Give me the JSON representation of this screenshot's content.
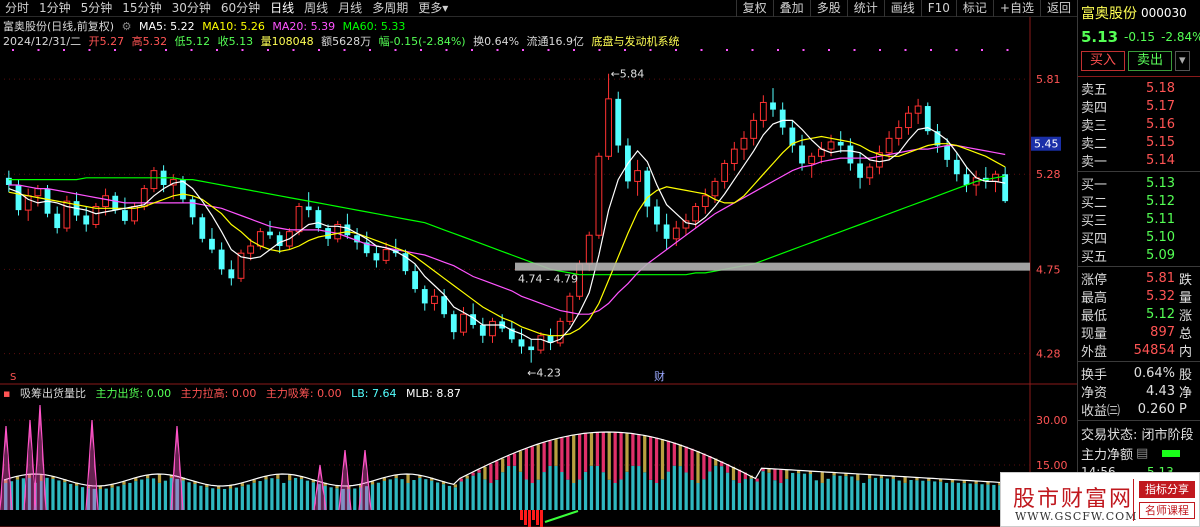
{
  "toolbar": {
    "tabs": [
      "分时",
      "1分钟",
      "5分钟",
      "15分钟",
      "30分钟",
      "60分钟",
      "日线",
      "周线",
      "月线",
      "多周期",
      "更多"
    ],
    "more_arrow": "▾",
    "buttons": [
      "复权",
      "叠加",
      "多股",
      "统计",
      "画线",
      "F10",
      "标记",
      "+自选",
      "返回"
    ]
  },
  "info": {
    "stock_title": "富奥股份(日线,前复权)",
    "ma5": "MA5: 5.22",
    "ma10": "MA10: 5.26",
    "ma20": "MA20: 5.39",
    "ma60": "MA60: 5.33",
    "date": "2024/12/31/二",
    "open": "开5.27",
    "high": "高5.32",
    "low": "低5.12",
    "close": "收5.13",
    "volume": "量108048",
    "amount": "额5628万",
    "change": "幅-0.15(-2.84%)",
    "turnover": "换0.64%",
    "float_cap": "流通16.9亿",
    "system": "底盘与发动机系统"
  },
  "chart_annotations": {
    "high_label": "5.84",
    "low_label": "4.23",
    "range_label": "4.74 - 4.79",
    "finance_mark": "财",
    "price_marker": "5.45"
  },
  "indicator": {
    "name": "吸筹出货量比",
    "main_out": "主力出货: 0.00",
    "main_up": "主力拉高: 0.00",
    "main_in": "主力吸筹: 0.00",
    "lb": "LB: 7.64",
    "mlb": "MLB: 8.87"
  },
  "colors": {
    "up": "#ff3232",
    "down": "#54ffff",
    "ma5": "#ffffff",
    "ma10": "#ffff00",
    "ma20": "#ff54ff",
    "ma60": "#00ff00"
  },
  "panel": {
    "name": "富奥股份",
    "code": "000030",
    "price": "5.13",
    "change": "-0.15",
    "pct": "-2.84%",
    "buy_btn": "买入",
    "sell_btn": "卖出",
    "more_btn": "▾",
    "asks": [
      {
        "label": "卖五",
        "price": "5.18"
      },
      {
        "label": "卖四",
        "price": "5.17"
      },
      {
        "label": "卖三",
        "price": "5.16"
      },
      {
        "label": "卖二",
        "price": "5.15"
      },
      {
        "label": "卖一",
        "price": "5.14"
      }
    ],
    "bids": [
      {
        "label": "买一",
        "price": "5.13"
      },
      {
        "label": "买二",
        "price": "5.12"
      },
      {
        "label": "买三",
        "price": "5.11"
      },
      {
        "label": "买四",
        "price": "5.10"
      },
      {
        "label": "买五",
        "price": "5.09"
      }
    ],
    "stats": [
      {
        "label": "涨停",
        "value": "5.81",
        "tail": "跌"
      },
      {
        "label": "最高",
        "value": "5.32",
        "tail": "量"
      },
      {
        "label": "最低",
        "value": "5.12",
        "tail": "涨"
      },
      {
        "label": "现量",
        "value": "897",
        "tail": "总"
      },
      {
        "label": "外盘",
        "value": "54854",
        "tail": "内"
      }
    ],
    "stats2": [
      {
        "label": "换手",
        "value": "0.64%",
        "tail": "股"
      },
      {
        "label": "净资",
        "value": "4.43",
        "tail": "净"
      },
      {
        "label": "收益㈢",
        "value": "0.260",
        "tail": "P"
      }
    ],
    "status": "交易状态: 闭市阶段",
    "main_flow": "主力净额",
    "tick_time": "14:56",
    "tick_price": "5.13"
  },
  "watermark": {
    "title": "股市财富网",
    "url": "WWW.GSCFW.COM",
    "tag1": "指标分享",
    "tag2": "名师课程"
  },
  "chart_data": {
    "type": "candlestick",
    "y_axis_ticks": [
      "5.81",
      "5.28",
      "4.75",
      "4.28"
    ],
    "indicator_ticks": [
      "30.00",
      "15.00"
    ],
    "price_range": [
      4.15,
      5.95
    ],
    "candles": [
      [
        5.26,
        5.3,
        5.18,
        5.22
      ],
      [
        5.22,
        5.25,
        5.05,
        5.08
      ],
      [
        5.08,
        5.2,
        5.02,
        5.16
      ],
      [
        5.16,
        5.22,
        5.1,
        5.2
      ],
      [
        5.2,
        5.22,
        5.04,
        5.06
      ],
      [
        5.06,
        5.1,
        4.95,
        4.98
      ],
      [
        4.98,
        5.16,
        4.96,
        5.13
      ],
      [
        5.13,
        5.18,
        5.02,
        5.05
      ],
      [
        5.05,
        5.1,
        4.96,
        5.0
      ],
      [
        5.0,
        5.12,
        4.98,
        5.1
      ],
      [
        5.1,
        5.2,
        5.05,
        5.16
      ],
      [
        5.16,
        5.18,
        5.06,
        5.08
      ],
      [
        5.08,
        5.15,
        5.0,
        5.02
      ],
      [
        5.02,
        5.12,
        5.0,
        5.1
      ],
      [
        5.1,
        5.22,
        5.08,
        5.2
      ],
      [
        5.2,
        5.32,
        5.18,
        5.3
      ],
      [
        5.3,
        5.33,
        5.18,
        5.22
      ],
      [
        5.22,
        5.28,
        5.14,
        5.25
      ],
      [
        5.25,
        5.27,
        5.12,
        5.14
      ],
      [
        5.14,
        5.16,
        5.0,
        5.04
      ],
      [
        5.04,
        5.06,
        4.9,
        4.92
      ],
      [
        4.92,
        4.98,
        4.84,
        4.86
      ],
      [
        4.86,
        4.9,
        4.72,
        4.75
      ],
      [
        4.75,
        4.8,
        4.66,
        4.7
      ],
      [
        4.7,
        4.86,
        4.68,
        4.84
      ],
      [
        4.84,
        4.92,
        4.8,
        4.88
      ],
      [
        4.88,
        4.98,
        4.86,
        4.96
      ],
      [
        4.96,
        5.02,
        4.92,
        4.94
      ],
      [
        4.94,
        4.96,
        4.84,
        4.88
      ],
      [
        4.88,
        4.98,
        4.86,
        4.96
      ],
      [
        4.96,
        5.12,
        4.94,
        5.1
      ],
      [
        5.1,
        5.18,
        5.04,
        5.08
      ],
      [
        5.08,
        5.1,
        4.96,
        4.98
      ],
      [
        4.98,
        5.0,
        4.88,
        4.92
      ],
      [
        4.92,
        5.02,
        4.9,
        5.0
      ],
      [
        5.0,
        5.06,
        4.92,
        4.94
      ],
      [
        4.94,
        4.98,
        4.86,
        4.9
      ],
      [
        4.9,
        4.96,
        4.82,
        4.84
      ],
      [
        4.84,
        4.88,
        4.76,
        4.8
      ],
      [
        4.8,
        4.9,
        4.78,
        4.86
      ],
      [
        4.86,
        4.92,
        4.82,
        4.84
      ],
      [
        4.84,
        4.86,
        4.72,
        4.74
      ],
      [
        4.74,
        4.78,
        4.62,
        4.64
      ],
      [
        4.64,
        4.66,
        4.52,
        4.56
      ],
      [
        4.56,
        4.64,
        4.52,
        4.6
      ],
      [
        4.6,
        4.64,
        4.48,
        4.5
      ],
      [
        4.5,
        4.52,
        4.36,
        4.4
      ],
      [
        4.4,
        4.54,
        4.38,
        4.5
      ],
      [
        4.5,
        4.56,
        4.42,
        4.44
      ],
      [
        4.44,
        4.48,
        4.34,
        4.38
      ],
      [
        4.38,
        4.48,
        4.34,
        4.46
      ],
      [
        4.46,
        4.5,
        4.4,
        4.42
      ],
      [
        4.42,
        4.46,
        4.34,
        4.36
      ],
      [
        4.36,
        4.42,
        4.28,
        4.32
      ],
      [
        4.32,
        4.36,
        4.23,
        4.3
      ],
      [
        4.3,
        4.4,
        4.28,
        4.38
      ],
      [
        4.38,
        4.42,
        4.3,
        4.34
      ],
      [
        4.34,
        4.48,
        4.32,
        4.46
      ],
      [
        4.46,
        4.62,
        4.44,
        4.6
      ],
      [
        4.6,
        4.8,
        4.58,
        4.78
      ],
      [
        4.78,
        4.96,
        4.74,
        4.94
      ],
      [
        4.94,
        5.4,
        4.92,
        5.38
      ],
      [
        5.38,
        5.84,
        5.36,
        5.7
      ],
      [
        5.7,
        5.74,
        5.4,
        5.44
      ],
      [
        5.44,
        5.48,
        5.2,
        5.24
      ],
      [
        5.24,
        5.36,
        5.16,
        5.3
      ],
      [
        5.3,
        5.32,
        5.04,
        5.1
      ],
      [
        5.1,
        5.14,
        4.96,
        5.0
      ],
      [
        5.0,
        5.06,
        4.86,
        4.92
      ],
      [
        4.92,
        5.02,
        4.88,
        4.98
      ],
      [
        4.98,
        5.06,
        4.94,
        5.02
      ],
      [
        5.02,
        5.12,
        4.98,
        5.1
      ],
      [
        5.1,
        5.2,
        5.06,
        5.16
      ],
      [
        5.16,
        5.26,
        5.12,
        5.24
      ],
      [
        5.24,
        5.36,
        5.2,
        5.34
      ],
      [
        5.34,
        5.46,
        5.3,
        5.42
      ],
      [
        5.42,
        5.52,
        5.36,
        5.48
      ],
      [
        5.48,
        5.62,
        5.44,
        5.58
      ],
      [
        5.58,
        5.72,
        5.54,
        5.68
      ],
      [
        5.68,
        5.76,
        5.6,
        5.64
      ],
      [
        5.64,
        5.68,
        5.5,
        5.54
      ],
      [
        5.54,
        5.58,
        5.4,
        5.44
      ],
      [
        5.44,
        5.5,
        5.3,
        5.34
      ],
      [
        5.34,
        5.4,
        5.26,
        5.38
      ],
      [
        5.38,
        5.46,
        5.34,
        5.42
      ],
      [
        5.42,
        5.5,
        5.38,
        5.46
      ],
      [
        5.46,
        5.52,
        5.4,
        5.44
      ],
      [
        5.44,
        5.48,
        5.3,
        5.34
      ],
      [
        5.34,
        5.4,
        5.2,
        5.26
      ],
      [
        5.26,
        5.34,
        5.22,
        5.32
      ],
      [
        5.32,
        5.44,
        5.28,
        5.4
      ],
      [
        5.4,
        5.52,
        5.36,
        5.48
      ],
      [
        5.48,
        5.58,
        5.44,
        5.54
      ],
      [
        5.54,
        5.66,
        5.5,
        5.62
      ],
      [
        5.62,
        5.7,
        5.56,
        5.66
      ],
      [
        5.66,
        5.68,
        5.5,
        5.52
      ],
      [
        5.52,
        5.56,
        5.4,
        5.44
      ],
      [
        5.44,
        5.48,
        5.32,
        5.36
      ],
      [
        5.36,
        5.4,
        5.24,
        5.28
      ],
      [
        5.28,
        5.32,
        5.18,
        5.22
      ],
      [
        5.22,
        5.3,
        5.16,
        5.26
      ],
      [
        5.26,
        5.32,
        5.2,
        5.24
      ],
      [
        5.24,
        5.3,
        5.18,
        5.28
      ],
      [
        5.28,
        5.32,
        5.12,
        5.13
      ]
    ],
    "ma5": [
      5.2,
      5.18,
      5.14,
      5.12,
      5.13,
      5.12,
      5.1,
      5.09,
      5.08,
      5.06,
      5.07,
      5.08,
      5.09,
      5.1,
      5.11,
      5.16,
      5.2,
      5.23,
      5.24,
      5.2,
      5.13,
      5.05,
      4.96,
      4.86,
      4.82,
      4.81,
      4.82,
      4.86,
      4.9,
      4.92,
      4.96,
      5.0,
      5.01,
      4.99,
      4.99,
      4.98,
      4.95,
      4.92,
      4.88,
      4.87,
      4.85,
      4.82,
      4.78,
      4.71,
      4.66,
      4.61,
      4.54,
      4.51,
      4.48,
      4.44,
      4.44,
      4.44,
      4.41,
      4.39,
      4.36,
      4.36,
      4.34,
      4.36,
      4.42,
      4.51,
      4.62,
      4.83,
      5.08,
      5.25,
      5.34,
      5.41,
      5.35,
      5.22,
      5.11,
      5.06,
      5.01,
      5.0,
      5.04,
      5.1,
      5.17,
      5.25,
      5.33,
      5.41,
      5.5,
      5.56,
      5.58,
      5.58,
      5.53,
      5.47,
      5.42,
      5.4,
      5.41,
      5.41,
      5.4,
      5.36,
      5.35,
      5.36,
      5.4,
      5.47,
      5.53,
      5.54,
      5.51,
      5.47,
      5.4,
      5.32,
      5.26,
      5.24,
      5.24,
      5.23
    ],
    "ma10": [
      5.18,
      5.17,
      5.16,
      5.15,
      5.14,
      5.13,
      5.12,
      5.11,
      5.1,
      5.09,
      5.09,
      5.09,
      5.09,
      5.09,
      5.1,
      5.12,
      5.14,
      5.16,
      5.17,
      5.16,
      5.14,
      5.1,
      5.06,
      5.0,
      4.96,
      4.91,
      4.88,
      4.86,
      4.85,
      4.86,
      4.88,
      4.91,
      4.93,
      4.94,
      4.95,
      4.96,
      4.95,
      4.93,
      4.91,
      4.89,
      4.87,
      4.85,
      4.82,
      4.78,
      4.74,
      4.7,
      4.66,
      4.62,
      4.58,
      4.54,
      4.51,
      4.48,
      4.46,
      4.43,
      4.41,
      4.39,
      4.38,
      4.38,
      4.39,
      4.42,
      4.47,
      4.56,
      4.69,
      4.82,
      4.95,
      5.07,
      5.15,
      5.19,
      5.21,
      5.2,
      5.19,
      5.18,
      5.17,
      5.14,
      5.12,
      5.12,
      5.16,
      5.22,
      5.28,
      5.34,
      5.4,
      5.45,
      5.47,
      5.48,
      5.49,
      5.48,
      5.47,
      5.46,
      5.44,
      5.41,
      5.39,
      5.38,
      5.38,
      5.4,
      5.42,
      5.44,
      5.45,
      5.45,
      5.44,
      5.42,
      5.4,
      5.38,
      5.35,
      5.32
    ],
    "ma20": [
      5.22,
      5.22,
      5.21,
      5.2,
      5.2,
      5.19,
      5.18,
      5.17,
      5.16,
      5.15,
      5.14,
      5.13,
      5.12,
      5.12,
      5.12,
      5.12,
      5.12,
      5.12,
      5.12,
      5.12,
      5.11,
      5.1,
      5.09,
      5.07,
      5.05,
      5.03,
      5.01,
      4.99,
      4.98,
      4.97,
      4.97,
      4.97,
      4.97,
      4.96,
      4.95,
      4.93,
      4.91,
      4.89,
      4.88,
      4.87,
      4.86,
      4.85,
      4.84,
      4.83,
      4.81,
      4.79,
      4.77,
      4.74,
      4.71,
      4.69,
      4.67,
      4.65,
      4.63,
      4.6,
      4.58,
      4.56,
      4.54,
      4.52,
      4.51,
      4.5,
      4.5,
      4.52,
      4.56,
      4.62,
      4.67,
      4.73,
      4.78,
      4.82,
      4.86,
      4.9,
      4.94,
      4.98,
      5.02,
      5.06,
      5.09,
      5.12,
      5.15,
      5.18,
      5.21,
      5.24,
      5.27,
      5.3,
      5.32,
      5.33,
      5.35,
      5.36,
      5.37,
      5.37,
      5.37,
      5.37,
      5.38,
      5.39,
      5.4,
      5.41,
      5.42,
      5.42,
      5.43,
      5.44,
      5.44,
      5.43,
      5.42,
      5.41,
      5.4,
      5.39
    ],
    "ma60": [
      5.25,
      5.25,
      5.25,
      5.25,
      5.25,
      5.25,
      5.25,
      5.25,
      5.26,
      5.26,
      5.26,
      5.26,
      5.26,
      5.26,
      5.26,
      5.26,
      5.26,
      5.26,
      5.25,
      5.25,
      5.24,
      5.23,
      5.22,
      5.21,
      5.2,
      5.19,
      5.18,
      5.17,
      5.16,
      5.15,
      5.14,
      5.13,
      5.12,
      5.11,
      5.1,
      5.09,
      5.08,
      5.07,
      5.06,
      5.05,
      5.04,
      5.03,
      5.02,
      5.01,
      4.99,
      4.97,
      4.95,
      4.93,
      4.91,
      4.89,
      4.87,
      4.85,
      4.83,
      4.81,
      4.79,
      4.77,
      4.75,
      4.74,
      4.73,
      4.72,
      4.72,
      4.72,
      4.72,
      4.72,
      4.72,
      4.72,
      4.72,
      4.72,
      4.72,
      4.72,
      4.72,
      4.73,
      4.73,
      4.74,
      4.75,
      4.76,
      4.77,
      4.78,
      4.8,
      4.82,
      4.84,
      4.86,
      4.88,
      4.9,
      4.92,
      4.94,
      4.96,
      4.98,
      5.0,
      5.02,
      5.04,
      5.06,
      5.08,
      5.1,
      5.12,
      5.14,
      5.16,
      5.18,
      5.2,
      5.22,
      5.24,
      5.25,
      5.26,
      5.27
    ]
  }
}
